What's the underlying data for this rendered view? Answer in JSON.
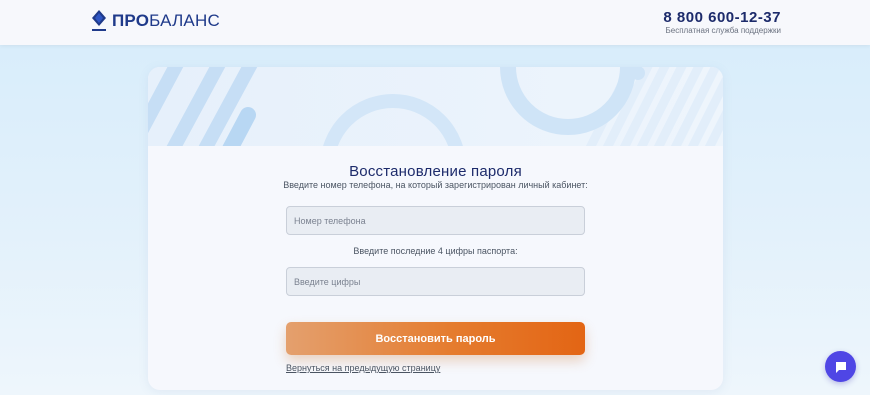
{
  "header": {
    "logo_bold": "ПРО",
    "logo_light": "БАЛАНС",
    "phone": "8 800 600-12-37",
    "phone_caption": "Бесплатная служба поддержки"
  },
  "form": {
    "title": "Восстановление пароля",
    "subtitle": "Введите номер телефона, на который зарегистрирован личный кабинет:",
    "phone_placeholder": "Номер телефона",
    "passport_label": "Введите последние 4 цифры паспорта:",
    "digits_placeholder": "Введите цифры",
    "submit_label": "Восстановить пароль",
    "back_link": "Вернуться на предыдущую страницу"
  },
  "colors": {
    "brand_blue": "#1f3a8a",
    "button_orange": "#e57c2f",
    "chat_purple": "#4f46e5"
  },
  "icons": {
    "logo": "diamond-logo-icon",
    "chat": "chat-bubble-icon"
  }
}
